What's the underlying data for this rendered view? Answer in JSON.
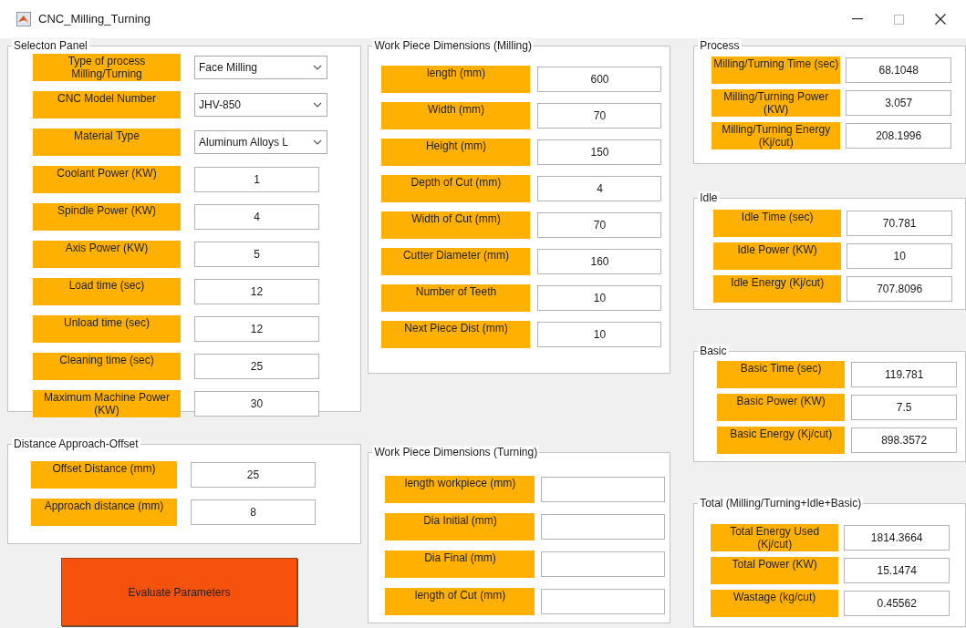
{
  "window": {
    "title": "CNC_Milling_Turning"
  },
  "selection_panel": {
    "title": "Selecton Panel",
    "rows": [
      {
        "label": "Type of process Milling/Turning",
        "kind": "dropdown",
        "value": "Face Milling"
      },
      {
        "label": "CNC Model Number",
        "kind": "dropdown",
        "value": "JHV-850"
      },
      {
        "label": "Material Type",
        "kind": "dropdown",
        "value": "Aluminum Alloys L"
      },
      {
        "label": "Coolant Power (KW)",
        "kind": "field",
        "value": "1"
      },
      {
        "label": "Spindle Power (KW)",
        "kind": "field",
        "value": "4"
      },
      {
        "label": "Axis Power (KW)",
        "kind": "field",
        "value": "5"
      },
      {
        "label": "Load time (sec)",
        "kind": "field",
        "value": "12"
      },
      {
        "label": "Unload time (sec)",
        "kind": "field",
        "value": "12"
      },
      {
        "label": "Cleaning time (sec)",
        "kind": "field",
        "value": "25"
      },
      {
        "label": "Maximum Machine Power (KW)",
        "kind": "field",
        "value": "30"
      }
    ]
  },
  "distance_panel": {
    "title": "Distance Approach-Offset",
    "rows": [
      {
        "label": "Offset Distance (mm)",
        "kind": "field",
        "value": "25"
      },
      {
        "label": "Approach distance (mm)",
        "kind": "field",
        "value": "8"
      }
    ]
  },
  "evaluate_button": {
    "label": "Evaluate Parameters"
  },
  "milling_panel": {
    "title": "Work Piece Dimensions (Milling)",
    "rows": [
      {
        "label": "length (mm)",
        "kind": "field",
        "value": "600"
      },
      {
        "label": "Width  (mm)",
        "kind": "field",
        "value": "70"
      },
      {
        "label": "Height (mm)",
        "kind": "field",
        "value": "150"
      },
      {
        "label": "Depth of Cut (mm)",
        "kind": "field",
        "value": "4"
      },
      {
        "label": "Width of Cut (mm)",
        "kind": "field",
        "value": "70"
      },
      {
        "label": "Cutter Diameter (mm)",
        "kind": "field",
        "value": "160"
      },
      {
        "label": "Number of Teeth",
        "kind": "field",
        "value": "10"
      },
      {
        "label": "Next Piece Dist (mm)",
        "kind": "field",
        "value": "10"
      }
    ]
  },
  "turning_panel": {
    "title": "Work Piece Dimensions (Turning)",
    "rows": [
      {
        "label": "length workpiece (mm)",
        "kind": "field"
      },
      {
        "label": "Dia Initial  (mm)",
        "kind": "field"
      },
      {
        "label": "Dia Final (mm)",
        "kind": "field"
      },
      {
        "label": "length of Cut (mm)",
        "kind": "field"
      }
    ]
  },
  "process_panel": {
    "title": "Process",
    "rows": [
      {
        "label": "Milling/Turning Time (sec)",
        "kind": "field",
        "value": "68.1048"
      },
      {
        "label": "Milling/Turning Power (KW)",
        "kind": "field",
        "value": "3.057"
      },
      {
        "label": "Milling/Turning Energy (Kj/cut)",
        "kind": "field",
        "value": "208.1996"
      }
    ]
  },
  "idle_panel": {
    "title": "Idle",
    "rows": [
      {
        "label": "Idle Time (sec)",
        "kind": "field",
        "value": "70.781"
      },
      {
        "label": "Idle Power (KW)",
        "kind": "field",
        "value": "10"
      },
      {
        "label": "Idle Energy (Kj/cut)",
        "kind": "field",
        "value": "707.8096"
      }
    ]
  },
  "basic_panel": {
    "title": "Basic",
    "rows": [
      {
        "label": "Basic Time (sec)",
        "kind": "field",
        "value": "119.781"
      },
      {
        "label": "Basic Power (KW)",
        "kind": "field",
        "value": "7.5"
      },
      {
        "label": "Basic Energy (Kj/cut)",
        "kind": "field",
        "value": "898.3572"
      }
    ]
  },
  "total_panel": {
    "title": "Total (Milling/Turning+Idle+Basic)",
    "rows": [
      {
        "label": "Total Energy Used (Kj/cut)",
        "kind": "field",
        "value": "1814.3664"
      },
      {
        "label": "Total Power (KW)",
        "kind": "field",
        "value": "15.1474"
      },
      {
        "label": "Wastage (kg/cut)",
        "kind": "field",
        "value": "0.45562"
      }
    ]
  }
}
